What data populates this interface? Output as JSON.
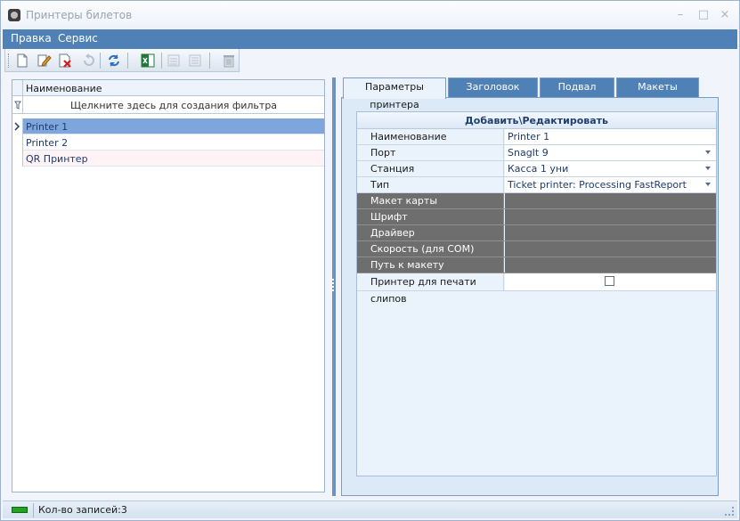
{
  "window": {
    "title": "Принтеры билетов",
    "controls": {
      "minimize": "–",
      "maximize": "□",
      "close": "×"
    }
  },
  "menu": {
    "items": [
      "Правка",
      "Сервис"
    ]
  },
  "toolbar": {
    "icons": [
      "new-document-icon",
      "edit-icon",
      "delete-icon",
      "undo-icon",
      "refresh-icon",
      "excel-export-icon",
      "move-up-icon",
      "move-down-icon",
      "trash-icon"
    ]
  },
  "grid": {
    "column_header": "Наименование",
    "filter_placeholder": "Щелкните здесь для создания фильтра",
    "rows": [
      {
        "name": "Printer 1",
        "selected": true
      },
      {
        "name": "Printer 2",
        "selected": false
      },
      {
        "name": "QR Принтер",
        "selected": false
      }
    ]
  },
  "tabs": [
    {
      "label": "Параметры принтера",
      "active": true
    },
    {
      "label": "Заголовок билета",
      "active": false
    },
    {
      "label": "Подвал билета",
      "active": false
    },
    {
      "label": "Макеты билетов",
      "active": false
    }
  ],
  "form": {
    "title": "Добавить\\Редактировать",
    "fields": [
      {
        "label": "Наименование",
        "value": "Printer 1",
        "dropdown": false,
        "disabled": false
      },
      {
        "label": "Порт",
        "value": "SnagIt 9",
        "dropdown": true,
        "disabled": false
      },
      {
        "label": "Станция",
        "value": "Касса 1 уни",
        "dropdown": true,
        "disabled": false
      },
      {
        "label": "Тип",
        "value": "Ticket printer: Processing FastReport",
        "dropdown": true,
        "disabled": false
      },
      {
        "label": "Макет карты",
        "value": "",
        "dropdown": false,
        "disabled": true
      },
      {
        "label": "Шрифт",
        "value": "",
        "dropdown": false,
        "disabled": true
      },
      {
        "label": "Драйвер",
        "value": "",
        "dropdown": false,
        "disabled": true
      },
      {
        "label": "Скорость (для COM)",
        "value": "",
        "dropdown": false,
        "disabled": true
      },
      {
        "label": "Путь к макету",
        "value": "",
        "dropdown": false,
        "disabled": true
      }
    ],
    "slip_printer": {
      "label": "Принтер для печати слипов",
      "checked": false
    }
  },
  "status": {
    "records": "Кол-во записей:3"
  },
  "colors": {
    "accent": "#4f80b6",
    "selected_row": "#7ea6dc",
    "disabled_row": "#6e6e6e",
    "status_ok": "#23a323"
  }
}
